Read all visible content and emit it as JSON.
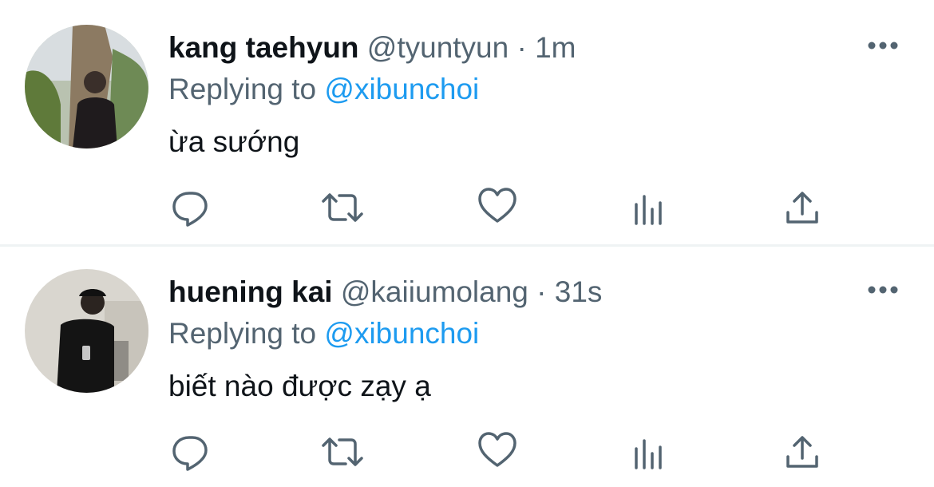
{
  "tweets": [
    {
      "display_name": "kang taehyun",
      "handle": "@tyuntyun",
      "separator": "·",
      "time": "1m",
      "replying_prefix": "Replying to",
      "replying_to": "@xibunchoi",
      "text": "ừa sướng"
    },
    {
      "display_name": "huening kai",
      "handle": "@kaiiumolang",
      "separator": "·",
      "time": "31s",
      "replying_prefix": "Replying to",
      "replying_to": "@xibunchoi",
      "text": "biết nào được zạy ạ"
    }
  ],
  "icons": {
    "more": "more-horizontal-icon",
    "reply": "reply-bubble-icon",
    "retweet": "retweet-icon",
    "like": "heart-icon",
    "analytics": "bar-chart-icon",
    "share": "share-upload-icon"
  },
  "colors": {
    "text_primary": "#0f1419",
    "text_secondary": "#536471",
    "accent": "#1d9bf0",
    "divider": "#eff3f4"
  }
}
